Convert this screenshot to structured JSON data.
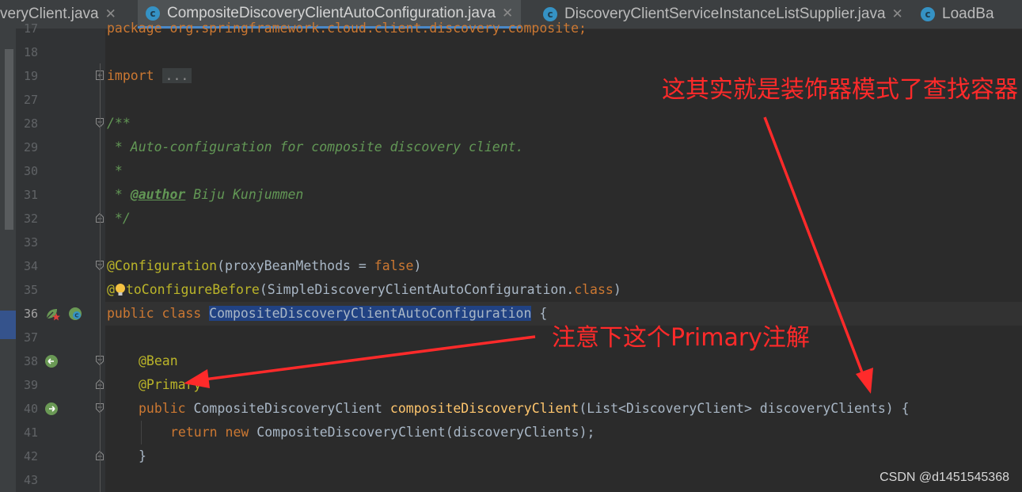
{
  "tabs": [
    {
      "label": "veryClient.java",
      "active": false
    },
    {
      "label": "CompositeDiscoveryClientAutoConfiguration.java",
      "active": true
    },
    {
      "label": "DiscoveryClientServiceInstanceListSupplier.java",
      "active": false
    },
    {
      "label": "LoadBa",
      "active": false
    }
  ],
  "tab_icon_letter": "c",
  "close_glyph": "✕",
  "gutter": {
    "line_numbers": [
      "17",
      "18",
      "19",
      "27",
      "28",
      "29",
      "30",
      "31",
      "32",
      "33",
      "34",
      "35",
      "36",
      "37",
      "38",
      "39",
      "40",
      "41",
      "42",
      "43"
    ],
    "current_line": "36"
  },
  "code": {
    "l17": {
      "text": "package org.springframework.cloud.client.discovery.composite;"
    },
    "l19": {
      "kw": "import",
      "dots": "..."
    },
    "l28": {
      "text": "/**"
    },
    "l29": {
      "text": " * Auto-configuration for composite discovery client."
    },
    "l30": {
      "text": " *"
    },
    "l31": {
      "pre": " * ",
      "tag": "@author",
      "post": " Biju Kunjummen"
    },
    "l32": {
      "text": " */"
    },
    "l34": {
      "an": "@Configuration",
      "p1": "(proxyBeanMethods = ",
      "kw": "false",
      "p2": ")"
    },
    "l35": {
      "an1": "@",
      "an2": "toConfigureBefore",
      "p1": "(SimpleDiscoveryClientAutoConfiguration.",
      "kw": "class",
      "p2": ")"
    },
    "l36": {
      "kw": "public class ",
      "sel": "CompositeDiscoveryClientAutoConfiguration",
      "post": " {"
    },
    "l38": {
      "an": "@Bean"
    },
    "l39": {
      "an": "@Primary"
    },
    "l40": {
      "kw": "public ",
      "type": "CompositeDiscoveryClient ",
      "fn": "compositeDiscoveryClient",
      "args": "(List<DiscoveryClient> discoveryClients) {"
    },
    "l41": {
      "kw": "return new ",
      "rest": "CompositeDiscoveryClient(discoveryClients);"
    },
    "l42": {
      "text": "}"
    }
  },
  "annotations": {
    "decorator_note": "这其实就是装饰器模式了查找容器",
    "primary_note": "注意下这个Primary注解",
    "color": "#ff2a2a"
  },
  "watermark": "CSDN @d1451545368",
  "colors": {
    "background": "#2b2b2b",
    "gutter": "#313335",
    "keyword": "#cc7832",
    "annotation": "#bbb529",
    "comment": "#629755",
    "method": "#ffc66d",
    "selection": "#214283"
  }
}
